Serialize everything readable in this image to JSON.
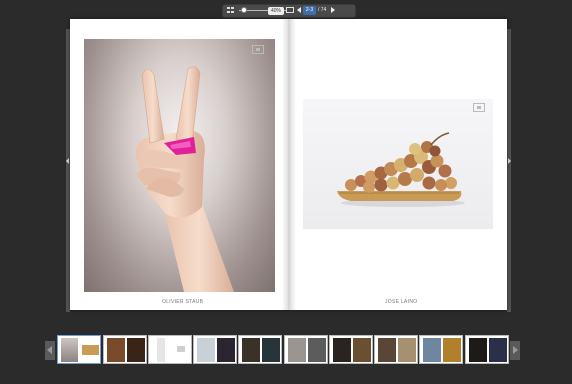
{
  "toolbar": {
    "zoom_label": "40%",
    "current_page": "2-3",
    "page_total": "/ 74"
  },
  "pages": {
    "left_caption": "OLIVIER STAUB",
    "right_caption": "JOSE LAINO"
  },
  "thumbnails": {
    "count": 10
  },
  "colors": {
    "background": "#2b2b2b",
    "toolbar": "#4a4a4a",
    "page_box": "#3f6fa8",
    "ring": "#e0219a"
  }
}
